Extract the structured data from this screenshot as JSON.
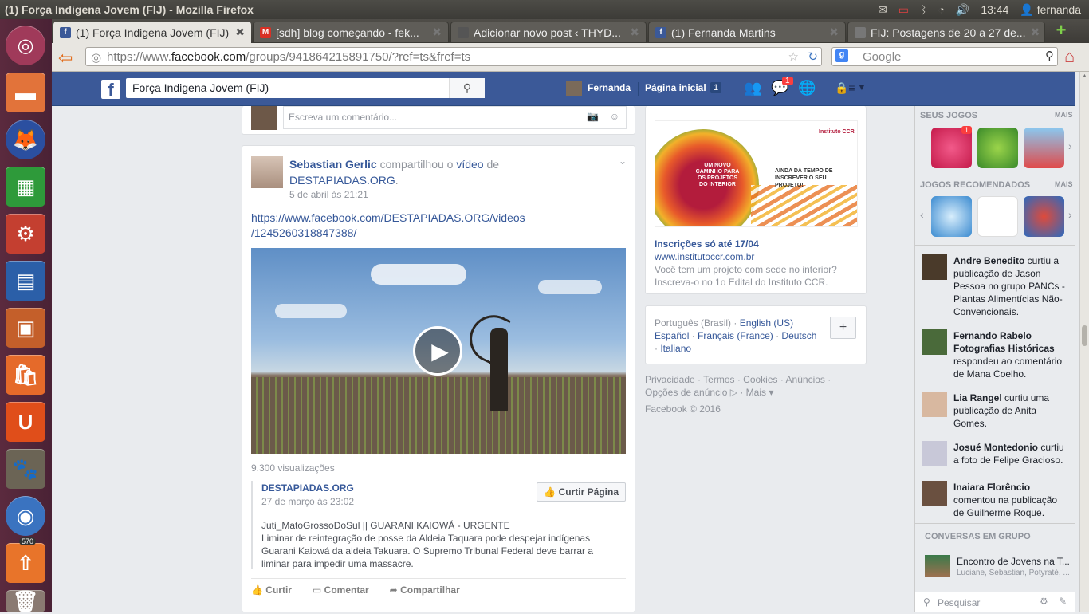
{
  "os": {
    "window_title": "(1) Força Indigena Jovem (FIJ) - Mozilla Firefox",
    "clock": "13:44",
    "user": "fernanda",
    "launcher_badge": "570"
  },
  "browser": {
    "tabs": [
      {
        "label": "(1) Força Indigena Jovem (FIJ)"
      },
      {
        "label": "[sdh] blog começando - fek..."
      },
      {
        "label": "Adicionar novo post ‹ THYD..."
      },
      {
        "label": "(1) Fernanda Martins"
      },
      {
        "label": "FIJ: Postagens de 20 a 27 de..."
      }
    ],
    "url_prefix": "https://www.",
    "url_domain": "facebook.com",
    "url_rest": "/groups/941864215891750/?ref=ts&fref=ts",
    "search_placeholder": "Google"
  },
  "fb": {
    "search_value": "Força Indigena Jovem (FIJ)",
    "profile_name": "Fernanda",
    "home_label": "Página inicial",
    "home_count": "1",
    "msg_badge": "1"
  },
  "comment_box": {
    "placeholder": "Escreva um comentário..."
  },
  "post": {
    "author": "Sebastian Gerlic",
    "action_1": " compartilhou o ",
    "action_link": "vídeo",
    "action_2": " de ",
    "page": "DESTAPIADAS.ORG",
    "page_dot": ".",
    "time": "5 de abril às 21:21",
    "link_line1": "https://www.facebook.com/DESTAPIADAS.ORG/videos",
    "link_line2": "/1245260318847388/",
    "views": "9.300 visualizações",
    "shared_page": "DESTAPIADAS.ORG",
    "shared_time": "27 de março às 23:02",
    "like_page_btn": "Curtir Página",
    "shared_title": "Juti_MatoGrossoDoSul || GUARANI KAIOWÁ - URGENTE",
    "shared_text_1": "Liminar de reintegração de posse da Aldeia Taquara pode despejar indígenas",
    "shared_text_2": "Guarani Kaiowá da aldeia Takuara. O Supremo Tribunal Federal deve barrar a",
    "shared_text_3": "liminar para impedir uma massacre.",
    "like": "Curtir",
    "comment": "Comentar",
    "share": "Compartilhar"
  },
  "ad": {
    "title": "Inscrições só até 17/04",
    "url": "www.institutoccr.com.br",
    "text_1": "Você tem um projeto com sede no interior?",
    "text_2": "Inscreva-o no 1o Edital do Instituto CCR.",
    "banner_text_1": "UM NOVO CAMINHO PARA OS PROJETOS DO INTERIOR",
    "banner_text_2": "AINDA DÁ TEMPO DE INSCREVER O SEU PROJETO!",
    "banner_brand": "Instituto CCR"
  },
  "languages": {
    "current": "Português (Brasil)",
    "links": [
      "English (US)",
      "Español",
      "Français (France)",
      "Deutsch",
      "Italiano"
    ],
    "plus": "+"
  },
  "footer": {
    "links": [
      "Privacidade",
      "Termos",
      "Cookies",
      "Anúncios",
      "Opções de anúncio",
      "Mais"
    ],
    "copyright": "Facebook © 2016"
  },
  "sidebar": {
    "games_label": "SEUS JOGOS",
    "more": "MAIS",
    "rec_label": "JOGOS RECOMENDADOS",
    "games_badge": "1",
    "ticker": [
      {
        "name": "Andre Benedito",
        "text": " curtiu a publicação de Jason Pessoa no grupo PANCs - Plantas Alimentícias Não-Convencionais."
      },
      {
        "name": "Fernando Rabelo Fotografias Históricas",
        "text": " respondeu ao comentário de Mana Coelho."
      },
      {
        "name": "Lia Rangel",
        "text": " curtiu uma publicação de Anita Gomes."
      },
      {
        "name": "Josué Montedonio",
        "text": " curtiu a foto de Felipe Gracioso."
      },
      {
        "name": "Inaiara Florêncio",
        "text": " comentou na publicação de Guilherme Roque."
      }
    ],
    "group_chats_label": "CONVERSAS EM GRUPO",
    "chat_name": "Encontro de Jovens na T...",
    "chat_members": "Luciane, Sebastian, Potyraté, ...",
    "search_placeholder": "Pesquisar"
  }
}
